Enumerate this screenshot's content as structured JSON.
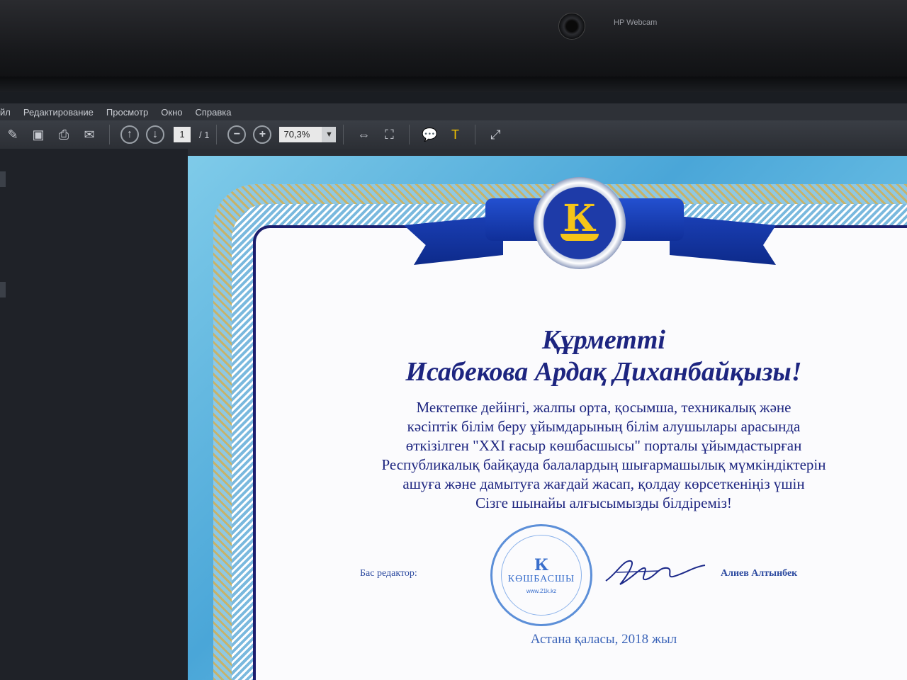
{
  "bezel": {
    "webcam_label": "HP Webcam"
  },
  "menu": [
    "йл",
    "Редактирование",
    "Просмотр",
    "Окно",
    "Справка"
  ],
  "toolbar": {
    "icons": [
      "edit-icon",
      "save-icon",
      "print-icon",
      "email-icon",
      "page-up-icon",
      "page-down-icon",
      "zoom-out-icon",
      "zoom-in-icon",
      "fit-width-icon",
      "fit-page-icon",
      "comment-icon",
      "highlight-icon",
      "fullscreen-icon"
    ],
    "page_current": "1",
    "page_total": "/ 1",
    "zoom_value": "70,3%"
  },
  "certificate": {
    "emblem_letter": "К",
    "title_line1": "Құрметті",
    "title_line2": "Исабекова Ардақ Диханбайқызы!",
    "body_lines": [
      "Мектепке дейінгі, жалпы орта, қосымша, техникалық және",
      "кәсіптік білім беру ұйымдарының білім алушылары арасында",
      "өткізілген \"XXI ғасыр көшбасшысы\" порталы ұйымдастырған",
      "Республикалық байқауда балалардың шығармашылық мүмкіндіктерін",
      "ашуға және дамытуға жағдай жасап, қолдау көрсеткеніңіз үшін",
      "Сізге шынайы алғысымызды білдіреміз!"
    ],
    "signature_label": "Бас редактор:",
    "stamp": {
      "letter": "К",
      "name": "КӨШБАСШЫ",
      "url": "www.21k.kz"
    },
    "signer": "Алиев Алтынбек",
    "footer": "Астана қаласы, 2018 жыл"
  }
}
